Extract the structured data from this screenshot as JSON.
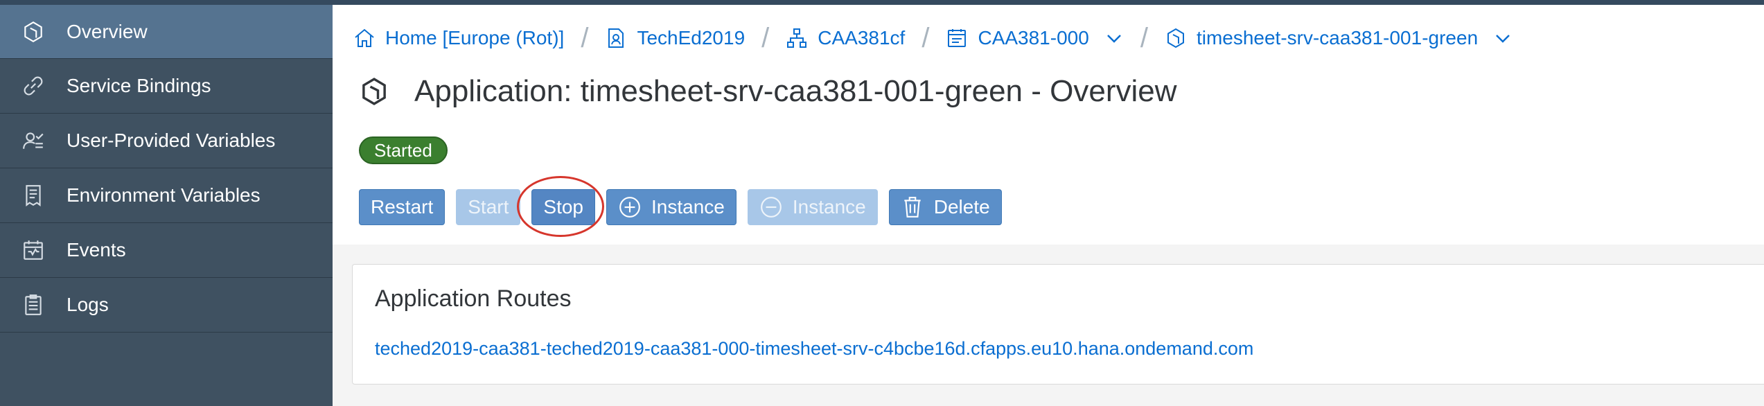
{
  "sidebar": {
    "items": [
      {
        "label": "Overview",
        "icon": "cube-icon",
        "active": true
      },
      {
        "label": "Service Bindings",
        "icon": "link-icon"
      },
      {
        "label": "User-Provided Variables",
        "icon": "user-settings-icon"
      },
      {
        "label": "Environment Variables",
        "icon": "document-icon"
      },
      {
        "label": "Events",
        "icon": "calendar-icon"
      },
      {
        "label": "Logs",
        "icon": "clipboard-icon"
      }
    ]
  },
  "breadcrumb": {
    "items": [
      {
        "label": "Home [Europe (Rot)]",
        "icon": "home-icon"
      },
      {
        "label": "TechEd2019",
        "icon": "global-account-icon"
      },
      {
        "label": "CAA381cf",
        "icon": "org-icon"
      },
      {
        "label": "CAA381-000",
        "icon": "space-icon",
        "dropdown": true
      },
      {
        "label": "timesheet-srv-caa381-001-green",
        "icon": "cube-icon",
        "dropdown": true
      }
    ]
  },
  "header": {
    "title": "Application: timesheet-srv-caa381-001-green - Overview",
    "status": "Started"
  },
  "toolbar": {
    "restart_label": "Restart",
    "start_label": "Start",
    "stop_label": "Stop",
    "add_instance_label": "Instance",
    "remove_instance_label": "Instance",
    "delete_label": "Delete"
  },
  "routes": {
    "title": "Application Routes",
    "items": [
      "teched2019-caa381-teched2019-caa381-000-timesheet-srv-c4bcbe16d.cfapps.eu10.hana.ondemand.com"
    ]
  },
  "colors": {
    "sidebar_bg": "#3f5161",
    "sidebar_active": "#557390",
    "link": "#0a6ed1",
    "status_green": "#3b7f2f",
    "button": "#5b8fc9",
    "highlight": "#d6362c"
  }
}
